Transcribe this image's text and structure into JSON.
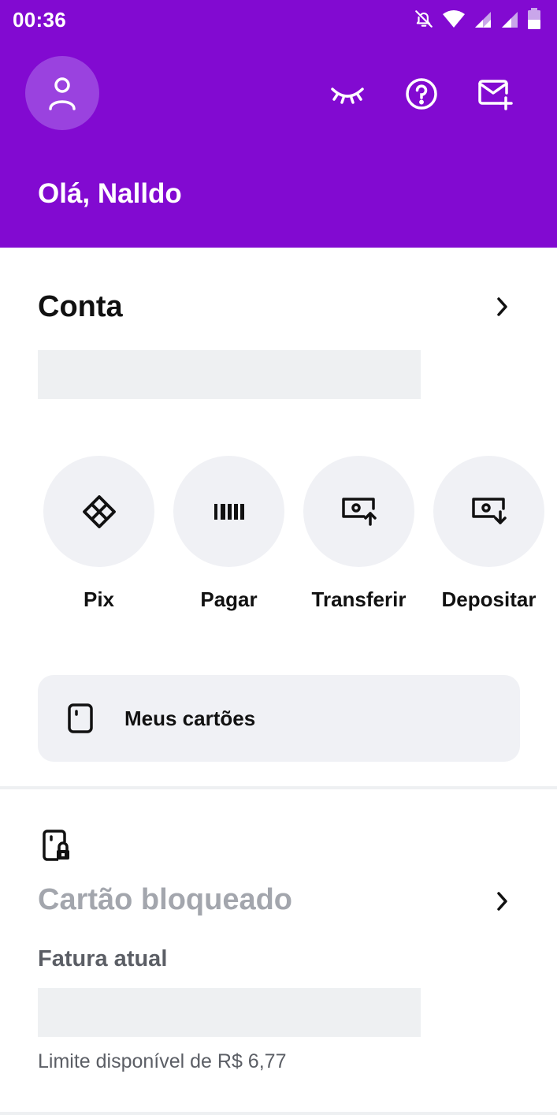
{
  "status_bar": {
    "time": "00:36",
    "icons": [
      "notifications-off-icon",
      "wifi-icon",
      "signal-icon",
      "signal-icon",
      "battery-icon"
    ]
  },
  "header": {
    "greeting": "Olá, Nalldo",
    "background_color": "#820ad1",
    "actions": [
      "hide-balance-icon",
      "help-icon",
      "invite-icon"
    ]
  },
  "account": {
    "title": "Conta"
  },
  "quick_actions": [
    {
      "label": "Pix",
      "icon": "pix-icon"
    },
    {
      "label": "Pagar",
      "icon": "barcode-icon"
    },
    {
      "label": "Transferir",
      "icon": "transfer-out-icon"
    },
    {
      "label": "Depositar",
      "icon": "deposit-icon"
    }
  ],
  "my_cards": {
    "label": "Meus cartões",
    "icon": "card-icon"
  },
  "credit_card": {
    "status": "Cartão bloqueado",
    "invoice_label": "Fatura atual",
    "limit_text": "Limite disponível de R$ 6,77",
    "icon": "card-locked-icon"
  }
}
